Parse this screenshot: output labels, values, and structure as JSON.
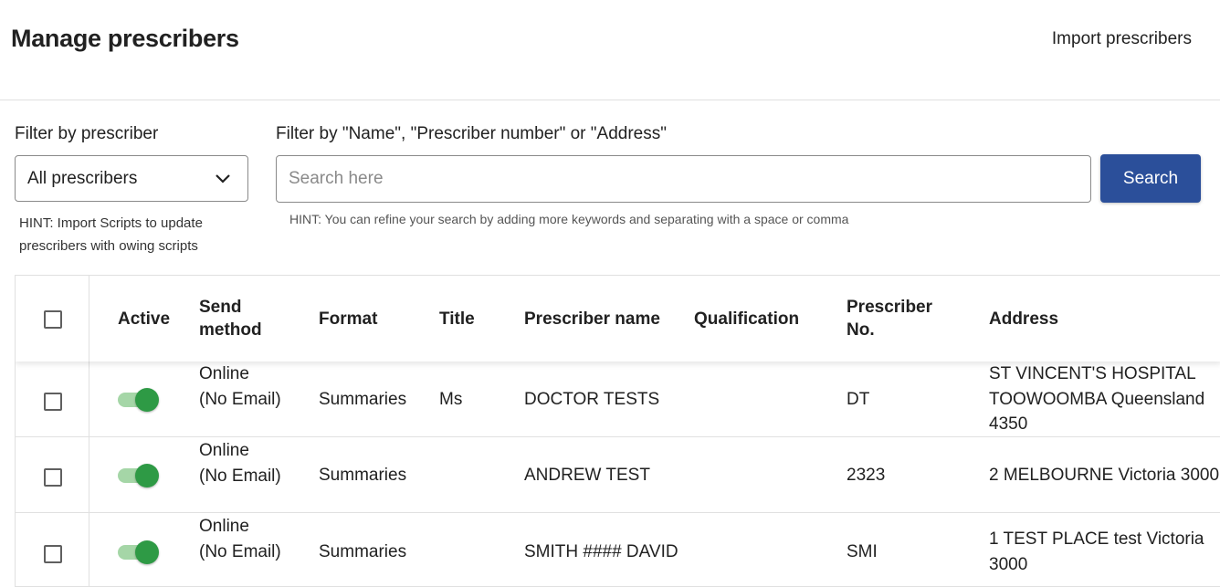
{
  "header": {
    "title": "Manage prescribers",
    "import_label": "Import prescribers"
  },
  "filters": {
    "prescriber_label": "Filter by prescriber",
    "prescriber_selected": "All prescribers",
    "search_label": "Filter by \"Name\", \"Prescriber number\" or \"Address\"",
    "search_placeholder": "Search here",
    "search_value": "",
    "search_button": "Search",
    "hint_left": "HINT: Import Scripts to update prescribers with owing scripts",
    "hint_right": "HINT: You can refine your search by adding more keywords and separating with a space or comma"
  },
  "table": {
    "headers": {
      "active": "Active",
      "send_method": "Send method",
      "format": "Format",
      "title": "Title",
      "prescriber_name": "Prescriber name",
      "qualification": "Qualification",
      "prescriber_no": "Prescriber No.",
      "address": "Address"
    },
    "rows": [
      {
        "active": true,
        "send_method": "Online (No Email)",
        "format": "Summaries",
        "title": "Ms",
        "prescriber_name": "DOCTOR TESTS",
        "qualification": "",
        "prescriber_no": "DT",
        "address": "ST VINCENT'S HOSPITAL TOOWOOMBA Queensland 4350"
      },
      {
        "active": true,
        "send_method": "Online (No Email)",
        "format": "Summaries",
        "title": "",
        "prescriber_name": "ANDREW TEST",
        "qualification": "",
        "prescriber_no": "2323",
        "address": "2 MELBOURNE Victoria 3000"
      },
      {
        "active": true,
        "send_method": "Online (No Email)",
        "format": "Summaries",
        "title": "",
        "prescriber_name": "SMITH #### DAVID",
        "qualification": "",
        "prescriber_no": "SMI",
        "address": "1 TEST PLACE test Victoria 3000"
      }
    ]
  },
  "colors": {
    "primary": "#2b4f9a",
    "toggle_on": "#2e9a45",
    "toggle_track": "#a5d6a7"
  }
}
